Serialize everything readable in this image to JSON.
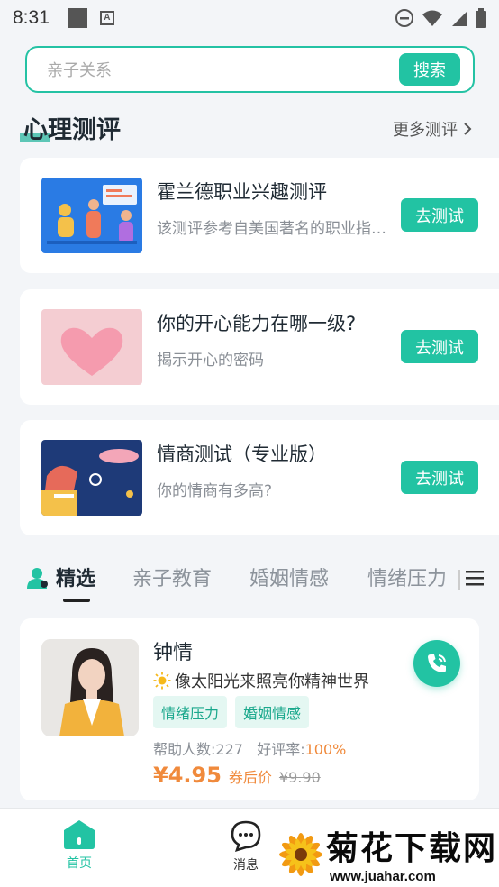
{
  "status_bar": {
    "time": "8:31"
  },
  "search": {
    "placeholder": "亲子关系",
    "button_label": "搜索"
  },
  "section": {
    "title": "心理测评",
    "more_label": "更多测评"
  },
  "assessments": [
    {
      "title": "霍兰德职业兴趣测评",
      "description": "该测评参考自美国著名的职业指导专家霍兰德",
      "button_label": "去测试"
    },
    {
      "title": "你的开心能力在哪一级?",
      "description": "揭示开心的密码",
      "button_label": "去测试"
    },
    {
      "title": "情商测试（专业版）",
      "description": "你的情商有多高?",
      "button_label": "去测试"
    }
  ],
  "tabs": [
    {
      "label": "精选",
      "active": true
    },
    {
      "label": "亲子教育",
      "active": false
    },
    {
      "label": "婚姻情感",
      "active": false
    },
    {
      "label": "情绪压力",
      "active": false
    }
  ],
  "expert": {
    "name": "钟情",
    "motto": "像太阳光来照亮你精神世界",
    "tags": [
      "情绪压力",
      "婚姻情感"
    ],
    "helped_label": "帮助人数:227",
    "rating_label": "好评率:",
    "rating_value": "100%",
    "price": "¥4.95",
    "price_note": "券后价",
    "original_price": "¥9.90"
  },
  "bottom_nav": {
    "home": "首页",
    "messages": "消息"
  },
  "watermark": {
    "text": "菊花下载网",
    "url": "www.juahar.com"
  },
  "colors": {
    "accent": "#22c3a3",
    "price": "#f08a3c"
  }
}
